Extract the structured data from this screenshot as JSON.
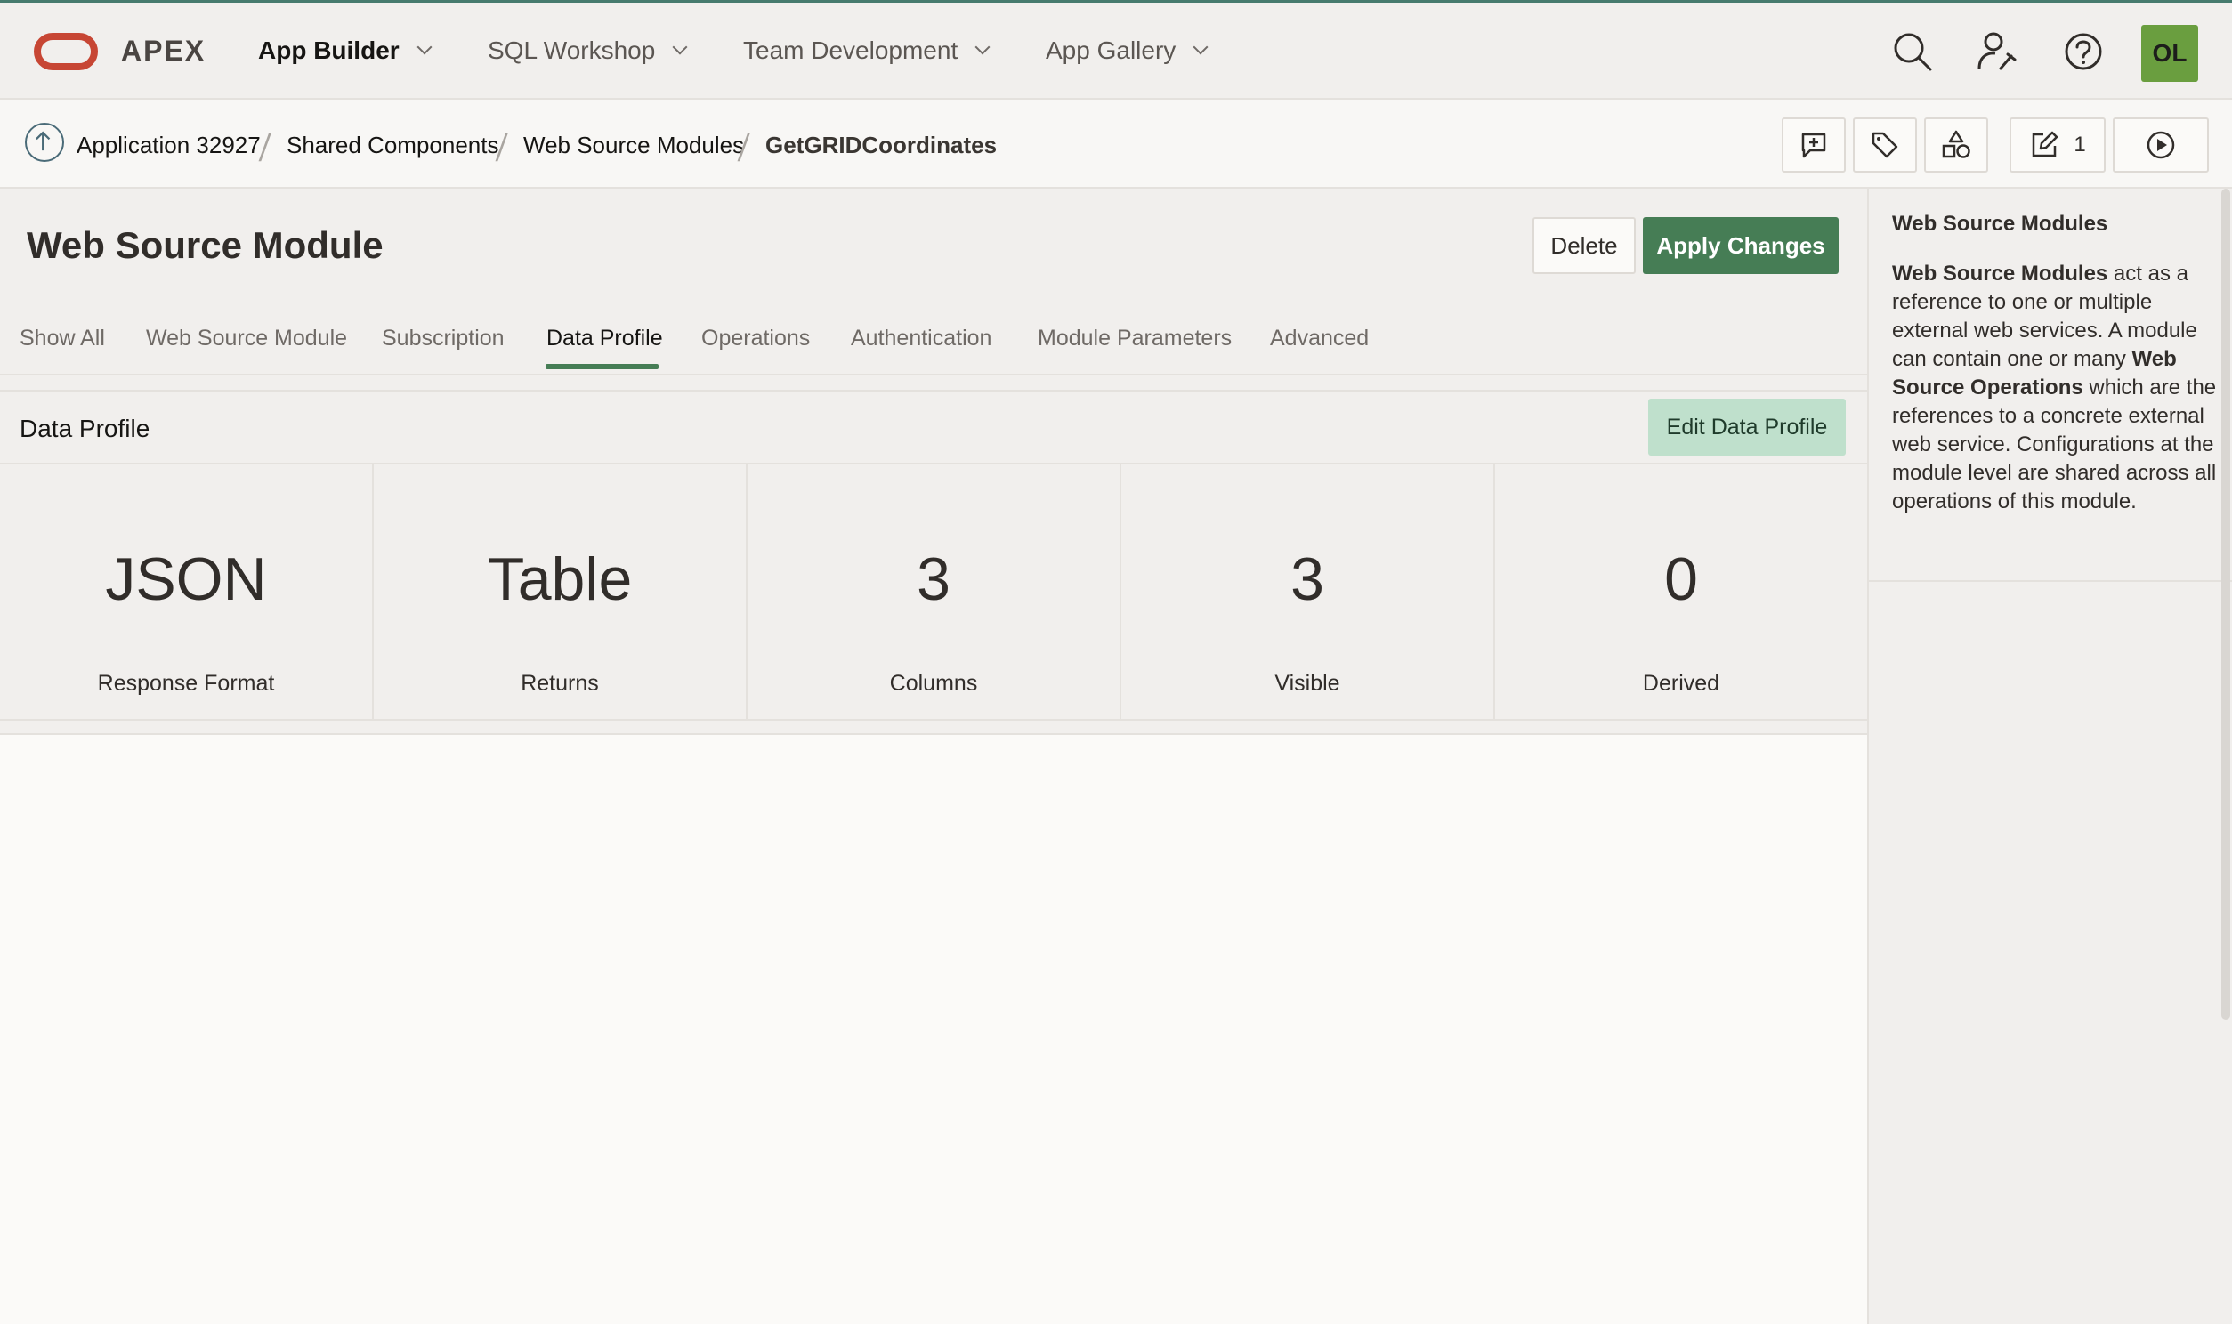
{
  "header": {
    "brand": "APEX",
    "menus": [
      {
        "label": "App Builder",
        "active": true
      },
      {
        "label": "SQL Workshop"
      },
      {
        "label": "Team Development"
      },
      {
        "label": "App Gallery"
      }
    ],
    "avatar": "OL",
    "icons": [
      "search-icon",
      "admin-user-icon",
      "help-icon"
    ]
  },
  "breadcrumb": {
    "items": [
      "Application 32927",
      "Shared Components",
      "Web Source Modules",
      "GetGRIDCoordinates"
    ],
    "toolbar": {
      "edit_count": "1"
    }
  },
  "page": {
    "title": "Web Source Module",
    "delete_label": "Delete",
    "apply_label": "Apply Changes",
    "tabs": [
      "Show All",
      "Web Source Module",
      "Subscription",
      "Data Profile",
      "Operations",
      "Authentication",
      "Module Parameters",
      "Advanced"
    ],
    "active_tab": "Data Profile"
  },
  "region": {
    "title": "Data Profile",
    "edit_label": "Edit Data Profile",
    "stats": [
      {
        "value": "JSON",
        "label": "Response Format"
      },
      {
        "value": "Table",
        "label": "Returns"
      },
      {
        "value": "3",
        "label": "Columns"
      },
      {
        "value": "3",
        "label": "Visible"
      },
      {
        "value": "0",
        "label": "Derived"
      }
    ]
  },
  "help": {
    "title": "Web Source Modules",
    "p1_b1": "Web Source Modules",
    "p1_t1": " act as a reference to one or multiple external web services. A module can contain one or many ",
    "p1_b2": "Web Source Operations",
    "p1_t2": " which are the references to a concrete external web service. Configurations at the module level are shared across all operations of this module."
  },
  "colors": {
    "accent": "#467d55",
    "logo": "#c74634",
    "avatar": "#6a9e3f",
    "edit_btn": "#bfe0cc"
  }
}
